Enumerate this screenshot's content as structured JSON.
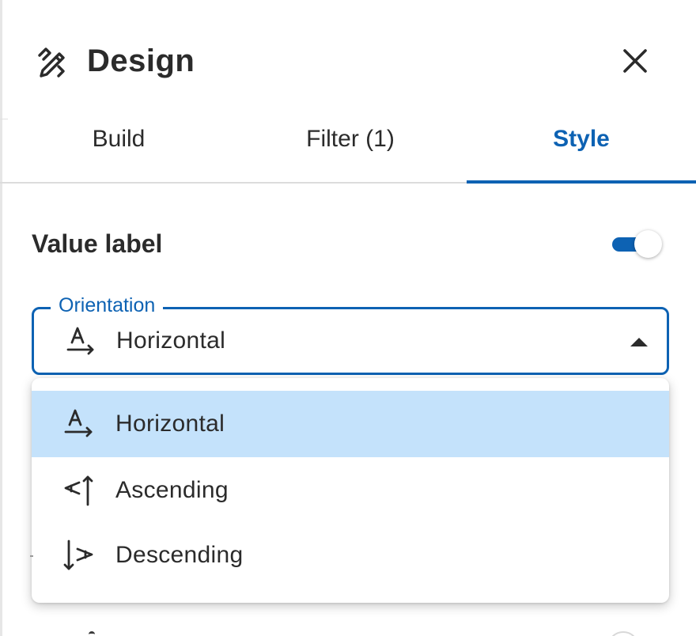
{
  "panel": {
    "title": "Design",
    "title_icon": "pencil-ruler-icon",
    "close_icon": "close-icon"
  },
  "tabs": [
    {
      "label": "Build",
      "active": false
    },
    {
      "label": "Filter (1)",
      "active": false
    },
    {
      "label": "Style",
      "active": true
    }
  ],
  "value_label": {
    "label": "Value label",
    "toggle_on": true
  },
  "orientation": {
    "label": "Orientation",
    "selected": "Horizontal",
    "selected_icon": "text-horizontal-icon",
    "expanded": true,
    "options": [
      {
        "label": "Horizontal",
        "icon": "text-horizontal-icon",
        "highlighted": true
      },
      {
        "label": "Ascending",
        "icon": "text-ascending-icon",
        "highlighted": false
      },
      {
        "label": "Descending",
        "icon": "text-descending-icon",
        "highlighted": false
      }
    ]
  },
  "colors": {
    "accent": "#0d62b3",
    "highlight": "#c4e2fb",
    "text": "#2b2b2b"
  }
}
